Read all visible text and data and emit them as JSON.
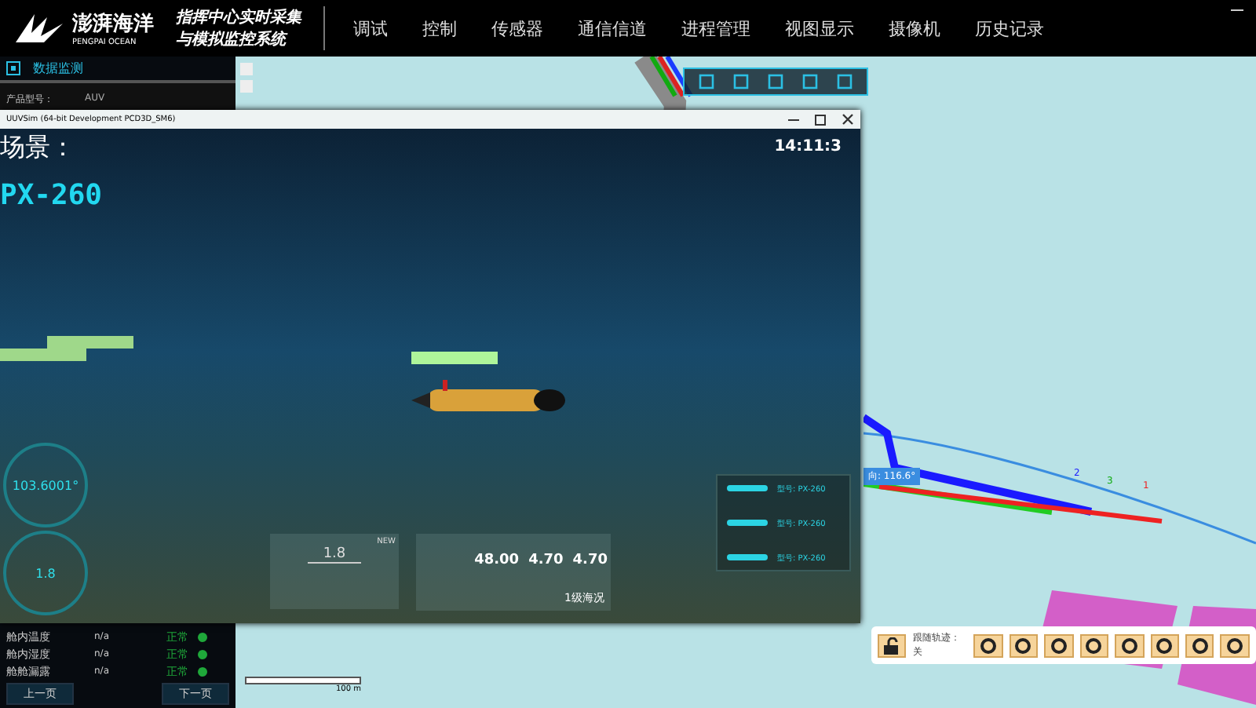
{
  "header": {
    "brand": "澎湃海洋",
    "brand_sub": "PENGPAI OCEAN",
    "title_lines": [
      "指挥中心实时采集",
      "与模拟监控系统"
    ],
    "nav": [
      "调试",
      "控制",
      "传感器",
      "通信信道",
      "进程管理",
      "视图显示",
      "摄像机",
      "历史记录"
    ]
  },
  "sidebar": {
    "section": "数据监测",
    "product_label": "产品型号：",
    "product_value": "AUV",
    "rows": [
      {
        "name": "舱内温度",
        "value": "n/a",
        "status": "正常",
        "color": "#1fa83a"
      },
      {
        "name": "舱内湿度",
        "value": "n/a",
        "status": "正常",
        "color": "#1fa83a"
      },
      {
        "name": "舱舱漏露",
        "value": "n/a",
        "status": "正常",
        "color": "#1fa83a"
      }
    ],
    "buttons": [
      "上一页",
      "下一页"
    ]
  },
  "map": {
    "heading_label": "向: 116.6°",
    "markers": [
      "2",
      "3",
      "1"
    ],
    "scale_label": "100 m",
    "follow_label": "跟随轨迹：关"
  },
  "sim_window": {
    "title": "UUVSim (64-bit Development PCD3D_SM6)",
    "scene_label": "场景：",
    "model": "PX-260",
    "time": "14:11:3",
    "heading": "103.6001°",
    "speed": "1.8",
    "panel_speed": "1.8",
    "panel_tag": "NEW",
    "readings": [
      "48.00",
      "4.70",
      "4.70"
    ],
    "sea_state": "1级海况",
    "vehicles": [
      "型号: PX-260",
      "型号: PX-260",
      "型号: PX-260"
    ]
  }
}
